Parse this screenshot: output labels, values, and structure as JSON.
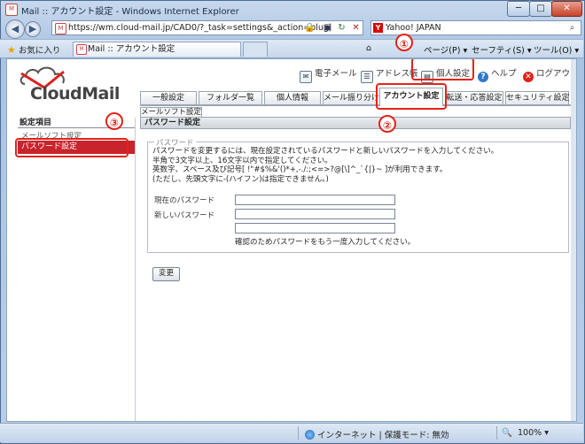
{
  "window": {
    "title": "Mail :: アカウント設定 - Windows Internet Explorer",
    "favicon_text": "M",
    "minimize": "─",
    "maximize": "□",
    "close": "✕"
  },
  "nav": {
    "back": "◀",
    "forward": "▶",
    "url": "https://wm.cloud-mail.jp/CAD0/?_task=settings&_action=plugi",
    "lock": "🔒",
    "refresh": "↻",
    "stop": "✕",
    "search_placeholder": "Yahoo! JAPAN",
    "search_icon": "⌕",
    "yahoo": "Y"
  },
  "favorites_bar": {
    "favorites": "お気に入り",
    "tab_title": "Mail :: アカウント設定",
    "home": "⌂",
    "page_menu": "ページ(P) ▾",
    "safety_menu": "セーフティ(S) ▾",
    "tools_menu": "ツール(O) ▾",
    "help": "❓▾"
  },
  "app": {
    "logo": "CloudMail",
    "toplinks": [
      {
        "label": "電子メール",
        "icon": "✉"
      },
      {
        "label": "アドレス帳",
        "icon": "☰"
      },
      {
        "label": "個人設定",
        "icon": "▤"
      },
      {
        "label": "ヘルプ",
        "icon": "?"
      },
      {
        "label": "ログアウト",
        "icon": "✕"
      }
    ],
    "tabs": [
      "一般設定",
      "フォルダ一覧",
      "個人情報",
      "メール振り分け",
      "アカウント設定",
      "転送・応答設定",
      "セキュリティ設定"
    ],
    "subtab": "メールソフト設定",
    "section_title": "パスワード設定",
    "sidebar": {
      "heading": "設定項目",
      "items": [
        "メールソフト設定",
        "パスワード設定"
      ]
    },
    "form": {
      "legend": "パスワード",
      "description": "パスワードを変更するには、現在設定されているパスワードと新しいパスワードを入力してください。\n半角で3文字以上、16文字以内で指定してください。\n英数字、スペース及び記号[ !\"#$%&'()*+,-./:;<=>?@[\\]^_`{|}~ ]が利用できます。\n(ただし、先頭文字に-(ハイフン)は指定できません。)",
      "current_label": "現在のパスワード",
      "new_label": "新しいパスワード",
      "confirm_note": "確認のためパスワードをもう一度入力してください。",
      "submit": "変更"
    },
    "callouts": [
      "①",
      "②",
      "③"
    ]
  },
  "status": {
    "zone": "インターネット | 保護モード: 無効",
    "zoom": "100%",
    "zoom_icon": "🔍"
  }
}
